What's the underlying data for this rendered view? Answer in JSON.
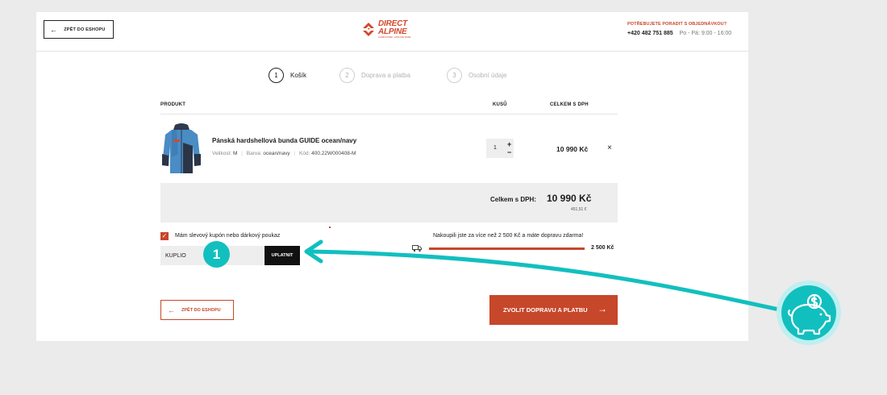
{
  "header": {
    "back_label": "ZPĚT DO ESHOPU",
    "logo_line1": "DIRECT",
    "logo_line2": "ALPINE",
    "logo_tagline": "CLIMB HIGHER · EXPLORE MORE",
    "help_question": "POTŘEBUJETE PORADIT S OBJEDNÁVKOU?",
    "phone": "+420 482 751 885",
    "hours": "Po - Pá: 9:00 - 16:00"
  },
  "steps": [
    {
      "num": "1",
      "label": "Košík"
    },
    {
      "num": "2",
      "label": "Doprava a platba"
    },
    {
      "num": "3",
      "label": "Osobní údaje"
    }
  ],
  "table": {
    "col_product": "PRODUKT",
    "col_qty": "KUSŮ",
    "col_total": "CELKEM S DPH"
  },
  "product": {
    "name": "Pánská hardshellová bunda GUIDE ocean/navy",
    "size_label": "Velikost:",
    "size": "M",
    "color_label": "Barva:",
    "color": "ocean/navy",
    "code_label": "Kód:",
    "code": "400.22W000408-M",
    "qty": "1",
    "qty_plus": "+",
    "qty_minus": "−",
    "price": "10 990 Kč",
    "remove": "×"
  },
  "totals": {
    "label": "Celkem s DPH:",
    "value": "10 990 Kč",
    "eur": "451,51 €"
  },
  "coupon": {
    "checkbox_mark": "✓",
    "label": "Mám slevový kupón nebo dárkový poukaz",
    "input_value": "KUPLIO",
    "apply_label": "UPLATNIT"
  },
  "shipping": {
    "message": "Nakoupili jste za více než 2 500 Kč a máte dopravu zdarma!",
    "threshold": "2 500 Kč",
    "progress": 1.0
  },
  "footer": {
    "back_label": "ZPĚT DO ESHOPU",
    "next_label": "ZVOLIT DOPRAVU A PLATBU",
    "arrow_left": "←",
    "arrow_right": "→"
  },
  "annotation": {
    "badge": "1",
    "accent": "#12bfbf"
  },
  "colors": {
    "brand": "#c7472a",
    "background": "#ebebeb"
  }
}
